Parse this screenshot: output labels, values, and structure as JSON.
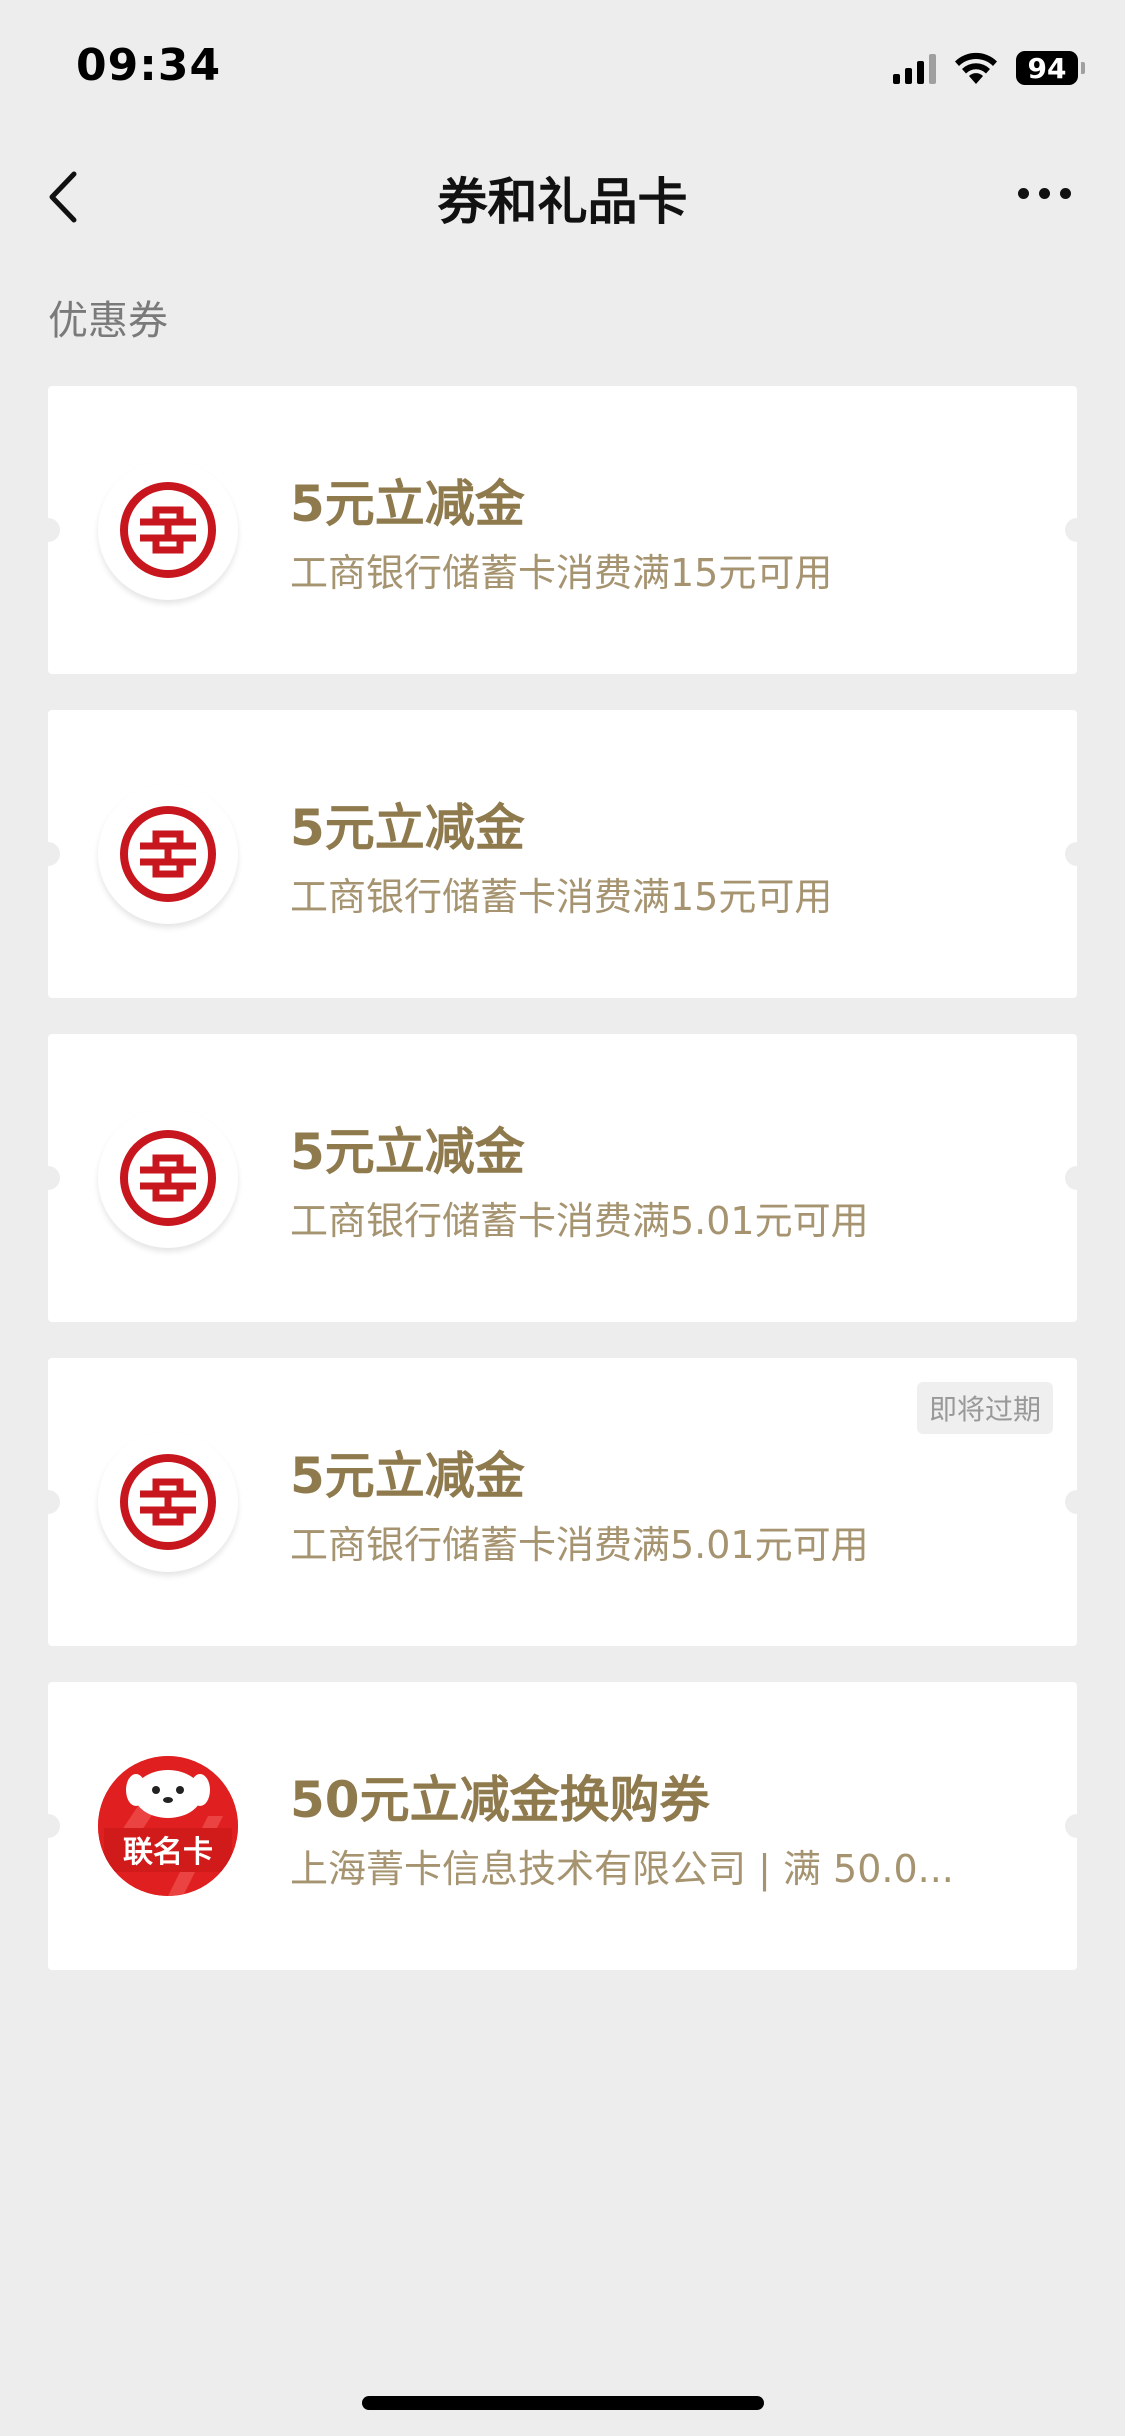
{
  "status_bar": {
    "time": "09:34",
    "battery": "94"
  },
  "nav": {
    "title": "券和礼品卡"
  },
  "section": {
    "title": "优惠券"
  },
  "coupons": [
    {
      "name": "5元立减金",
      "desc": "工商银行储蓄卡消费满15元可用",
      "logo": "icbc-logo-icon",
      "badge": ""
    },
    {
      "name": "5元立减金",
      "desc": "工商银行储蓄卡消费满15元可用",
      "logo": "icbc-logo-icon",
      "badge": ""
    },
    {
      "name": "5元立减金",
      "desc": "工商银行储蓄卡消费满5.01元可用",
      "logo": "icbc-logo-icon",
      "badge": ""
    },
    {
      "name": "5元立减金",
      "desc": "工商银行储蓄卡消费满5.01元可用",
      "logo": "icbc-logo-icon",
      "badge": "即将过期"
    },
    {
      "name": "50元立减金换购券",
      "desc": "上海菁卡信息技术有限公司 | 满 50.0...",
      "logo": "joint-card-logo-icon",
      "logo_text": "联名卡",
      "badge": ""
    }
  ],
  "colors": {
    "background": "#ededed",
    "coupon_title": "#8f7a4e",
    "coupon_desc": "#a69471",
    "icbc_red": "#c7161e",
    "card_red": "#e02020"
  }
}
